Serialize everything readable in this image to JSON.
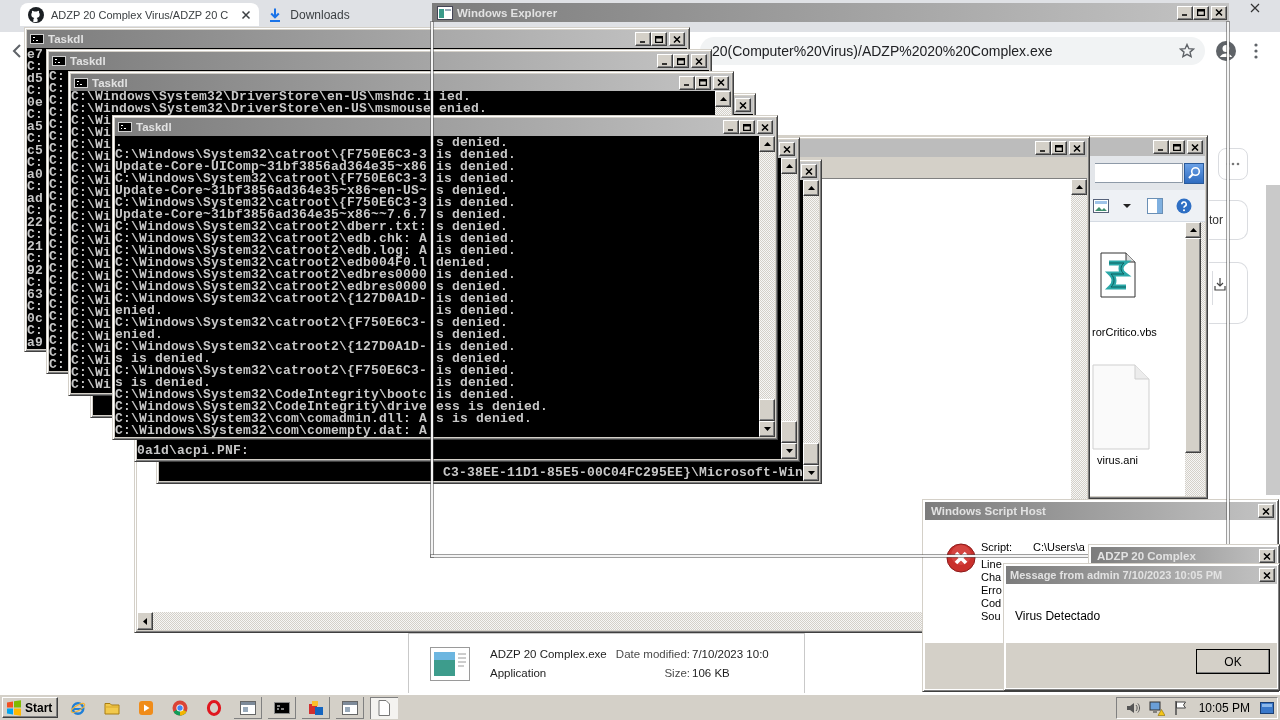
{
  "browser": {
    "tabs": [
      {
        "title": "ADZP 20 Complex Virus/ADZP 20 C",
        "selected": true
      },
      {
        "title": "Downloads",
        "selected": false
      }
    ],
    "address": "20(Computer%20Virus)/ADZP%2020%20Complex.exe",
    "side_card_text": "tor"
  },
  "explorer": {
    "title": "Windows Explorer",
    "files": [
      {
        "name": "rorCritico.vbs",
        "kind": "script"
      },
      {
        "name": "virus.ani",
        "kind": "blank"
      }
    ]
  },
  "details_pane": {
    "file_name": "ADZP 20 Complex.exe",
    "date_label": "Date modified:",
    "date_value": "7/10/2023 10:0",
    "file_type": "Application",
    "size_label": "Size:",
    "size_value": "106 KB"
  },
  "hidden_consoles": [
    {
      "lines": [
        "C3-38EE-11D1-85E5-00C04FC295EE}\\Microsoft-Win"
      ]
    },
    {
      "lines": [
        "0a1d\\acpi.PNF:"
      ]
    }
  ],
  "back_consoles": [
    {
      "title": "Taskdl",
      "lines": [
        "e7",
        "C:",
        "d5",
        "C:",
        "0e",
        "C:",
        "a5",
        "C:",
        "c5",
        "C:",
        "a0",
        "C:",
        "ad",
        "C:",
        "22",
        "C:",
        "21",
        "C:",
        "92",
        "C:",
        "63",
        "C:",
        "0c",
        "C:",
        "a9"
      ]
    },
    {
      "title": "Taskdl",
      "lines": [
        "C:",
        "C:",
        "C:",
        "C:",
        "C:",
        "C:",
        "C:",
        "C:",
        "C:",
        "C:",
        "C:",
        "C:",
        "C:",
        "C:",
        "C:",
        "C:",
        "C:",
        "C:",
        "C:",
        "C:",
        "C:",
        "C:",
        "C:",
        "C:",
        "C:"
      ]
    },
    {
      "title": "Taskdl",
      "lines": [
        "C:\\Windows\\System32\\DriverStore\\en-US\\mshdc.i ied.",
        "C:\\Windows\\System32\\DriverStore\\en-US\\msmouse enied.",
        "C:\\Wi",
        "C:\\Wi",
        "C:\\Wi",
        "C:\\Wi",
        "C:\\Wi",
        "C:\\Wi",
        "C:\\Wi",
        "C:\\Wi",
        "C:\\Wi",
        "C:\\Wi",
        "C:\\Wi",
        "C:\\Wi",
        "C:\\Wi",
        "C:\\Wi",
        "C:\\Wi",
        "C:\\Wi",
        "C:\\Wi",
        "C:\\Wi",
        "C:\\Wi",
        "C:\\Wi",
        "C:\\Wi",
        "C:\\Wi",
        "C:\\Wi"
      ]
    }
  ],
  "front_console": {
    "title": "Taskdl",
    "lines": [
      {
        "left": ".",
        "right": "s denied."
      },
      {
        "left": "C:\\Windows\\System32\\catroot\\{F750E6C3-3",
        "right": "is denied."
      },
      {
        "left": "Update-Core-UIComp~31bf3856ad364e35~x86",
        "right": "is denied."
      },
      {
        "left": "C:\\Windows\\System32\\catroot\\{F750E6C3-3",
        "right": "is denied."
      },
      {
        "left": "Update-Core~31bf3856ad364e35~x86~en-US~",
        "right": "s denied."
      },
      {
        "left": "C:\\Windows\\System32\\catroot\\{F750E6C3-3",
        "right": "is denied."
      },
      {
        "left": "Update-Core~31bf3856ad364e35~x86~~7.6.7",
        "right": "s denied."
      },
      {
        "left": "C:\\Windows\\System32\\catroot2\\dberr.txt:",
        "right": "s denied."
      },
      {
        "left": "C:\\Windows\\System32\\catroot2\\edb.chk: A",
        "right": "is denied."
      },
      {
        "left": "C:\\Windows\\System32\\catroot2\\edb.log: A",
        "right": "is denied."
      },
      {
        "left": "C:\\Windows\\System32\\catroot2\\edb004F0.l",
        "right": "denied."
      },
      {
        "left": "C:\\Windows\\System32\\catroot2\\edbres0000",
        "right": "is denied."
      },
      {
        "left": "C:\\Windows\\System32\\catroot2\\edbres0000",
        "right": "s denied."
      },
      {
        "left": "C:\\Windows\\System32\\catroot2\\{127D0A1D-",
        "right": "is denied."
      },
      {
        "left": "enied.",
        "right": "is denied."
      },
      {
        "left": "C:\\Windows\\System32\\catroot2\\{F750E6C3-",
        "right": "s denied."
      },
      {
        "left": "enied.",
        "right": "s denied."
      },
      {
        "left": "C:\\Windows\\System32\\catroot2\\{127D0A1D-",
        "right": "is denied."
      },
      {
        "left": "s is denied.",
        "right": "s denied."
      },
      {
        "left": "C:\\Windows\\System32\\catroot2\\{F750E6C3-",
        "right": "is denied."
      },
      {
        "left": "s is denied.",
        "right": "is denied."
      },
      {
        "left": "C:\\Windows\\System32\\CodeIntegrity\\bootc",
        "right": "is denied."
      },
      {
        "left": "C:\\Windows\\System32\\CodeIntegrity\\drive",
        "right": "ess is denied."
      },
      {
        "left": "C:\\Windows\\System32\\com\\comadmin.dll: A",
        "right": "s is denied."
      },
      {
        "left": "C:\\Windows\\System32\\com\\comempty.dat: A"
      }
    ]
  },
  "script_host": {
    "title": "Windows Script Host",
    "labels": [
      "Script:",
      "Line",
      "Cha",
      "Erro",
      "Cod",
      "Sou"
    ],
    "script_value": "C:\\Users\\a"
  },
  "adzp_dialog": {
    "title": "ADZP 20 Complex"
  },
  "message_dialog": {
    "title": "Message from admin 7/10/2023 10:05 PM",
    "text": "Virus Detectado",
    "button": "OK"
  },
  "taskbar": {
    "start": "Start",
    "buttons": [
      {
        "selected": false
      },
      {
        "selected": false
      },
      {
        "selected": false
      },
      {
        "selected": false
      },
      {
        "selected": false
      },
      {
        "selected": false
      },
      {
        "selected": false
      },
      {
        "selected": false
      },
      {
        "selected": false
      },
      {
        "selected": true
      }
    ],
    "clock": "10:05 PM"
  }
}
